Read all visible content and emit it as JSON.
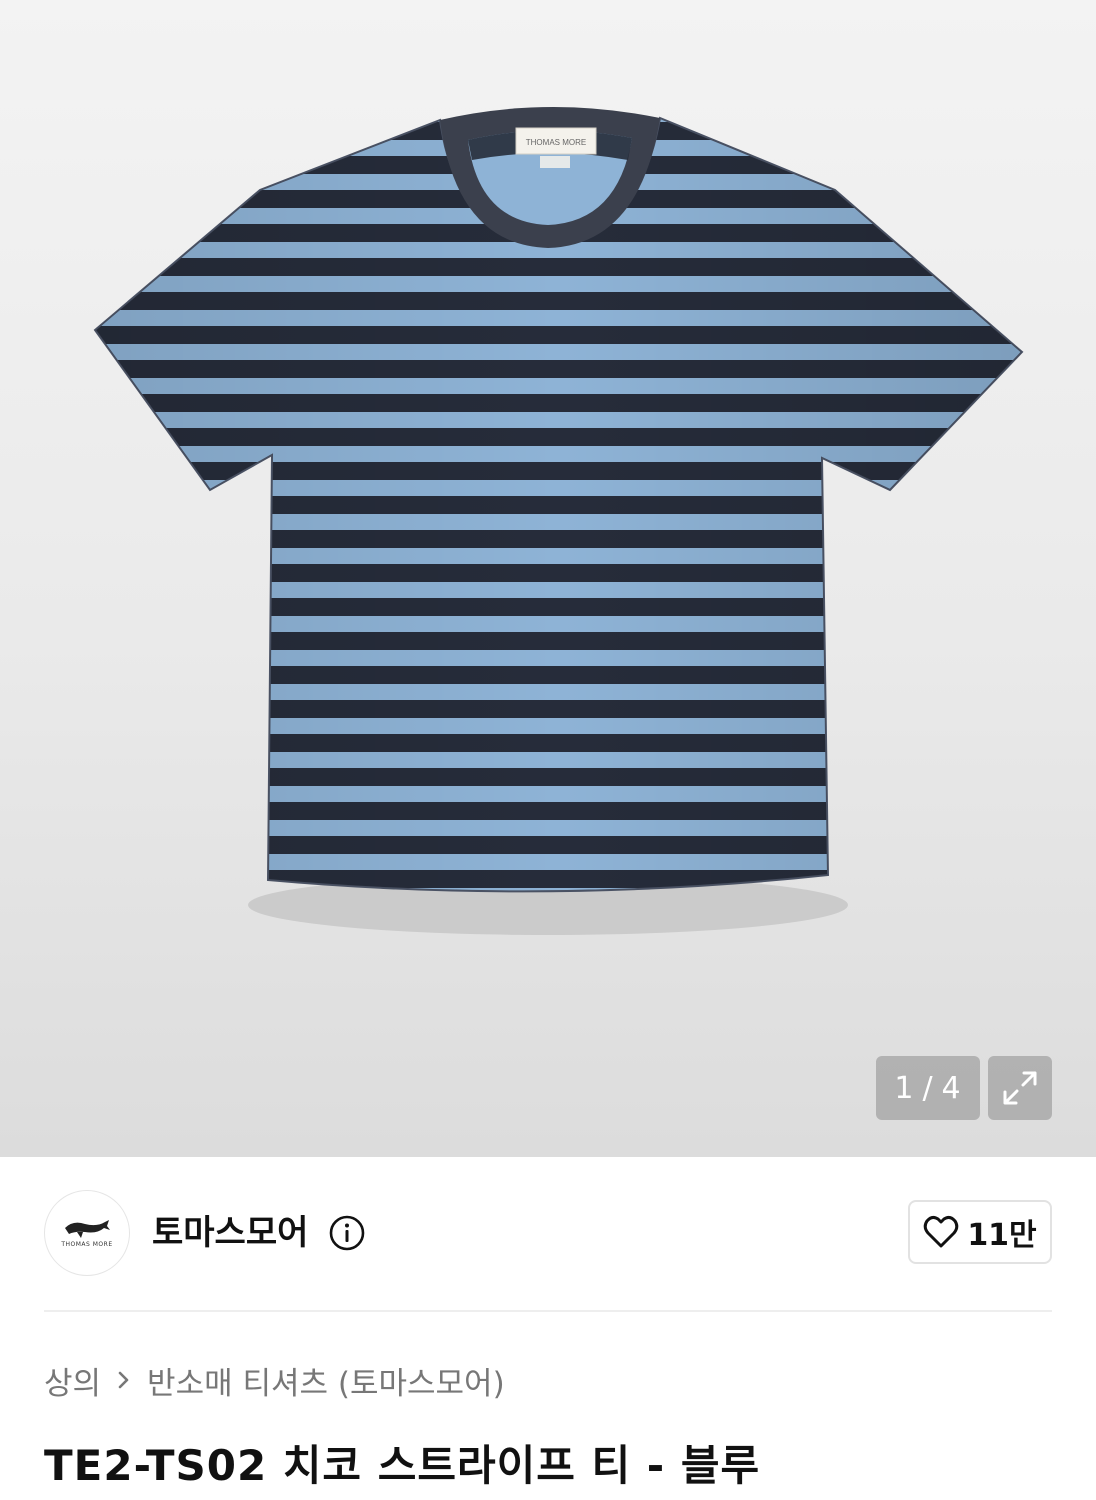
{
  "gallery": {
    "counter_current": "1",
    "counter_separator": "/",
    "counter_total": "4",
    "shirt_label": "THOMAS MORE",
    "stripe_colors": {
      "light": "#8eb3d6",
      "dark": "#262c3a"
    },
    "expand_icon": "expand-arrows-icon"
  },
  "brand": {
    "name": "토마스모어",
    "logo_text": "THOMAS MORE",
    "info_icon": "info-icon"
  },
  "like": {
    "icon": "heart-icon",
    "count": "11만"
  },
  "breadcrumb": {
    "category": "상의",
    "separator_icon": "chevron-right-icon",
    "subcategory": "반소매 티셔츠 (토마스모어)"
  },
  "product": {
    "title": "TE2-TS02 치코 스트라이프 티 - 블루"
  }
}
